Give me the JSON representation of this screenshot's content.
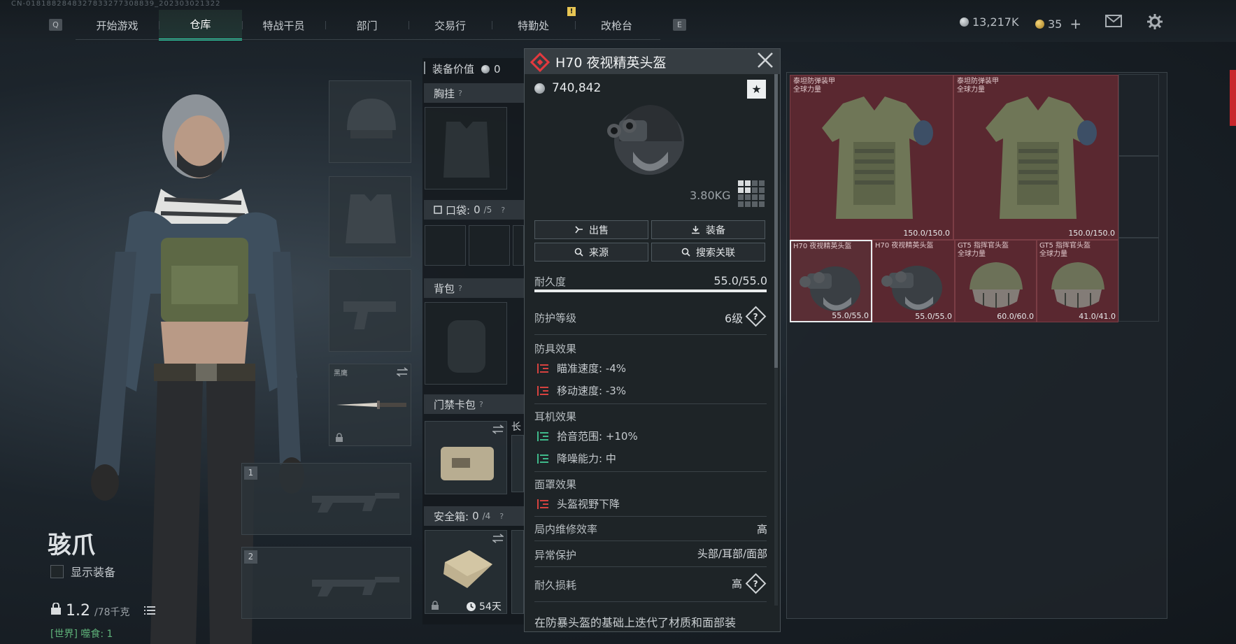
{
  "session_id": "CN-0181882848327833277308839_202303021322",
  "top_nav": {
    "left_key": "Q",
    "right_key": "E",
    "tabs": [
      {
        "label": "开始游戏",
        "active": false
      },
      {
        "label": "仓库",
        "active": true
      },
      {
        "label": "特战干员",
        "active": false
      },
      {
        "label": "部门",
        "active": false
      },
      {
        "label": "交易行",
        "active": false
      },
      {
        "label": "特勤处",
        "active": false
      },
      {
        "label": "改枪台",
        "active": false
      }
    ],
    "alert": "!"
  },
  "header_right": {
    "silver": "13,217K",
    "gold": "35",
    "gold_add": "+",
    "mail_icon": "mail-icon",
    "settings_icon": "gear-icon"
  },
  "character": {
    "name": "骇爪",
    "show_equipment_label": "显示装备",
    "weight_value": "1.2",
    "weight_capacity": "/78千克",
    "world_chat": "[世界] 噬食: 1"
  },
  "equip_slots": {
    "melee_label": "黑鹰",
    "primary_num": "1",
    "secondary_num": "2"
  },
  "gear_column": {
    "value_label": "装备价值",
    "value": "0",
    "chest_rig": "胸挂",
    "pockets": "口袋:",
    "pockets_count": "0",
    "pockets_max": "/5",
    "backpack": "背包",
    "keycard": "门禁卡包",
    "keycard_side": "长",
    "secure_box": "安全箱:",
    "secure_count": "0",
    "secure_max": "/4",
    "secure_timer": "54天",
    "question_mark": "?"
  },
  "item_detail": {
    "title": "H70 夜视精英头盔",
    "price": "740,842",
    "favorite_icon": "★",
    "weight": "3.80KG",
    "actions": [
      {
        "label": "出售",
        "icon": "sell-icon"
      },
      {
        "label": "装备",
        "icon": "equip-icon"
      },
      {
        "label": "来源",
        "icon": "search-icon"
      },
      {
        "label": "搜索关联",
        "icon": "search-icon"
      }
    ],
    "durability_label": "耐久度",
    "durability_value": "55.0/55.0",
    "durability_pct": 100,
    "protection_label": "防护等级",
    "protection_value": "6级",
    "armor_effects_title": "防具效果",
    "armor_effects": [
      {
        "label": "瞄准速度: -4%",
        "type": "negative"
      },
      {
        "label": "移动速度: -3%",
        "type": "negative"
      }
    ],
    "headset_effects_title": "耳机效果",
    "headset_effects": [
      {
        "label": "拾音范围: +10%",
        "type": "positive"
      },
      {
        "label": "降噪能力: 中",
        "type": "positive"
      }
    ],
    "mask_effects_title": "面罩效果",
    "mask_effects": [
      {
        "label": "头盔视野下降",
        "type": "negative"
      }
    ],
    "repair_label": "局内维修效率",
    "repair_value": "高",
    "abnormal_label": "异常保护",
    "abnormal_value": "头部/耳部/面部",
    "wear_label": "耐久损耗",
    "wear_value": "高",
    "description": "在防暴头盔的基础上迭代了材质和面部装",
    "colors": {
      "negative": "#d6423f",
      "positive": "#3fb98a",
      "rarity": "#e4393e"
    }
  },
  "inventory": {
    "items": [
      {
        "name": "泰坦防弹装甲\n全球力量",
        "durability": "150.0/150.0"
      },
      {
        "name": "泰坦防弹装甲\n全球力量",
        "durability": "150.0/150.0"
      },
      {
        "name": "H70 夜视精英头盔",
        "durability": "55.0/55.0",
        "selected": true
      },
      {
        "name": "H70 夜视精英头盔",
        "durability": "55.0/55.0"
      },
      {
        "name": "GT5 指挥官头盔\n全球力量",
        "durability": "60.0/60.0"
      },
      {
        "name": "GT5 指挥官头盔\n全球力量",
        "durability": "41.0/41.0"
      }
    ]
  }
}
